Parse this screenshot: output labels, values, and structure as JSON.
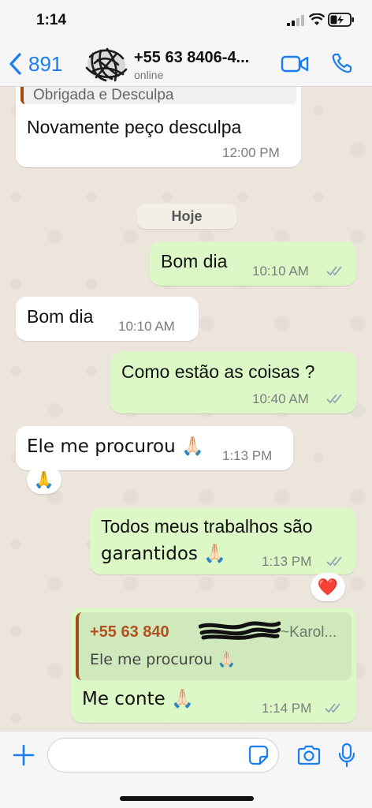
{
  "status_bar": {
    "time": "1:14"
  },
  "header": {
    "back_count": "891",
    "contact_name": "+55 63 8406-4...",
    "contact_status": "online"
  },
  "chat": {
    "date_chip": "Hoje",
    "messages": [
      {
        "direction": "incoming",
        "quoted_partial": "Obrigada e Desculpa",
        "text": "Novamente peço desculpa",
        "time": "12:00 PM"
      },
      {
        "direction": "outgoing",
        "text": "Bom dia",
        "time": "10:10 AM",
        "read": true
      },
      {
        "direction": "incoming",
        "text": "Bom dia",
        "time": "10:10 AM"
      },
      {
        "direction": "outgoing",
        "text": "Como estão as coisas ?",
        "time": "10:40 AM",
        "read": true
      },
      {
        "direction": "incoming",
        "text": "Ele me procurou 🙏🏻",
        "time": "1:13 PM",
        "reaction": "🙏"
      },
      {
        "direction": "outgoing",
        "text_line1": "Todos meus trabalhos são",
        "text_line2": "garantidos 🙏🏻",
        "time": "1:13 PM",
        "read": true,
        "reaction": "❤️"
      },
      {
        "direction": "outgoing",
        "quote": {
          "sender": "+55 63 840",
          "name": "~Karol...",
          "text": "Ele me procurou 🙏🏻"
        },
        "text": "Me conte 🙏🏻",
        "time": "1:14 PM",
        "read": true
      }
    ]
  },
  "colors": {
    "accent": "#1a7ef2",
    "outgoing_bubble": "#dcf8c6",
    "incoming_bubble": "#ffffff",
    "read_ticks": "#8ca3b5",
    "quote_sender": "#b3501f"
  },
  "icons": [
    "back-chevron-icon",
    "video-call-icon",
    "phone-icon",
    "plus-icon",
    "sticker-icon",
    "camera-icon",
    "microphone-icon"
  ]
}
